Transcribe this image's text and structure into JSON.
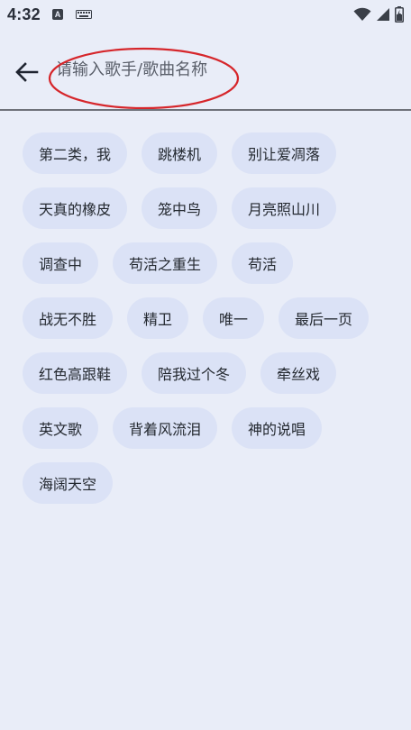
{
  "status_bar": {
    "time": "4:32",
    "notification_badge": "A",
    "icons": [
      "notification-a-icon",
      "keyboard-icon",
      "wifi-icon",
      "signal-icon",
      "battery-icon"
    ]
  },
  "search": {
    "placeholder": "请输入歌手/歌曲名称",
    "value": ""
  },
  "chips": {
    "rows": [
      [
        "第二类，我",
        "跳楼机",
        "别让爱凋落"
      ],
      [
        "天真的橡皮",
        "笼中鸟",
        "月亮照山川"
      ],
      [
        "调查中",
        "苟活之重生",
        "苟活"
      ],
      [
        "战无不胜",
        "精卫",
        "唯一",
        "最后一页"
      ],
      [
        "红色高跟鞋",
        "陪我过个冬",
        "牵丝戏"
      ],
      [
        "英文歌",
        "背着风流泪",
        "神的说唱"
      ],
      [
        "海阔天空"
      ]
    ]
  },
  "colors": {
    "background": "#e9edf8",
    "chip_background": "#dbe2f6",
    "annotation": "#d6262b",
    "divider": "#6f727a"
  }
}
